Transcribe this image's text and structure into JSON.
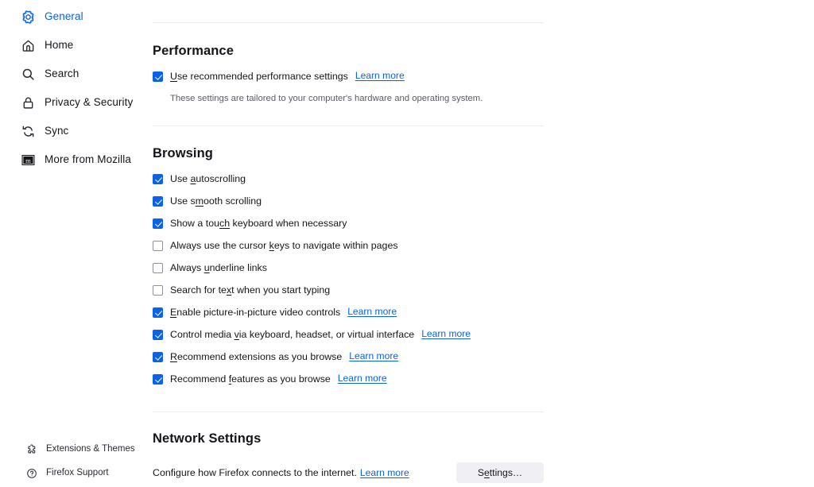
{
  "sidebar": {
    "items": [
      {
        "label": "General",
        "icon": "gear-icon",
        "selected": true
      },
      {
        "label": "Home",
        "icon": "home-icon",
        "selected": false
      },
      {
        "label": "Search",
        "icon": "search-icon",
        "selected": false
      },
      {
        "label": "Privacy & Security",
        "icon": "lock-icon",
        "selected": false
      },
      {
        "label": "Sync",
        "icon": "sync-icon",
        "selected": false
      },
      {
        "label": "More from Mozilla",
        "icon": "mozilla-m-icon",
        "selected": false
      }
    ],
    "footer": [
      {
        "label": "Extensions & Themes",
        "icon": "puzzle-piece-icon"
      },
      {
        "label": "Firefox Support",
        "icon": "question-circle-icon"
      }
    ]
  },
  "performance": {
    "title": "Performance",
    "recommended": {
      "label_pre": "",
      "label_key": "U",
      "label_post": "se recommended performance settings",
      "checked": true,
      "learn_more": "Learn more"
    },
    "note": "These settings are tailored to your computer's hardware and operating system."
  },
  "browsing": {
    "title": "Browsing",
    "options": [
      {
        "pre": "Use ",
        "key": "a",
        "post": "utoscrolling",
        "checked": true,
        "learn_more": ""
      },
      {
        "pre": "Use s",
        "key": "m",
        "post": "ooth scrolling",
        "checked": true,
        "learn_more": ""
      },
      {
        "pre": "Show a tou",
        "key": "ch",
        "post": " keyboard when necessary",
        "checked": true,
        "learn_more": ""
      },
      {
        "pre": "Always use the cursor ",
        "key": "k",
        "post": "eys to navigate within pages",
        "checked": false,
        "learn_more": ""
      },
      {
        "pre": "Always ",
        "key": "u",
        "post": "nderline links",
        "checked": false,
        "learn_more": ""
      },
      {
        "pre": "Search for te",
        "key": "x",
        "post": "t when you start typing",
        "checked": false,
        "learn_more": ""
      },
      {
        "pre": "",
        "key": "E",
        "post": "nable picture-in-picture video controls",
        "checked": true,
        "learn_more": "Learn more"
      },
      {
        "pre": "Control media ",
        "key": "v",
        "post": "ia keyboard, headset, or virtual interface",
        "checked": true,
        "learn_more": "Learn more"
      },
      {
        "pre": "",
        "key": "R",
        "post": "ecommend extensions as you browse",
        "checked": true,
        "learn_more": "Learn more"
      },
      {
        "pre": "Recommend ",
        "key": "f",
        "post": "eatures as you browse",
        "checked": true,
        "learn_more": "Learn more"
      }
    ]
  },
  "network": {
    "title": "Network Settings",
    "description": "Configure how Firefox connects to the internet.",
    "learn_more": "Learn more",
    "button_pre": "S",
    "button_key": "e",
    "button_post": "ttings…"
  },
  "colors": {
    "accent": "#0a62e8",
    "link": "#0a62e8",
    "text": "#15141a",
    "muted": "#5b5b66",
    "divider": "#ededf0",
    "button_bg": "#f0f0f4"
  }
}
